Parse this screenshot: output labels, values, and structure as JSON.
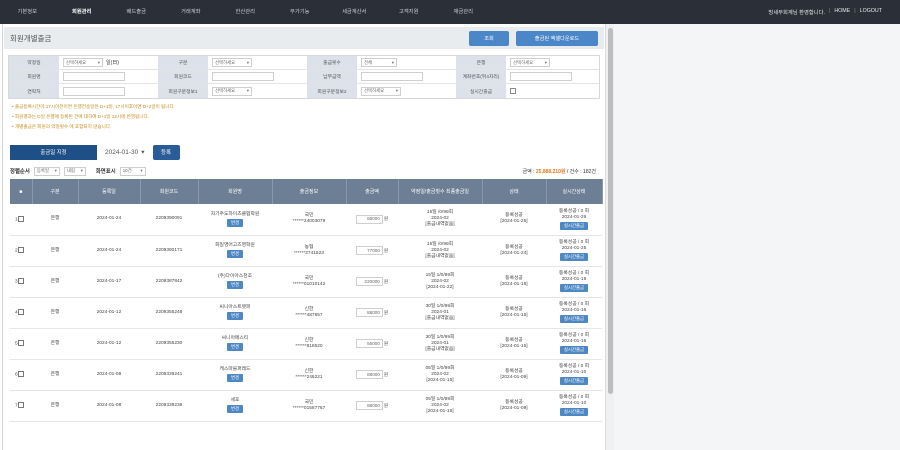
{
  "nav": {
    "items": [
      "기본정보",
      "회원관리",
      "배드출금",
      "거래계좌",
      "한산관리",
      "부가기능",
      "세금계산서",
      "고객지원",
      "재금관리"
    ],
    "right": {
      "user": "빙세무회계님 환영합니다.",
      "home": "HOME",
      "logout": "LOGOUT"
    }
  },
  "page": {
    "title": "회원개별출금",
    "search_button": "조회",
    "excel_button": "출금된 엑셀다운로드"
  },
  "filters": {
    "rows": [
      [
        {
          "label": "약정일",
          "value": "선택하세요",
          "extra": "일(日)"
        },
        {
          "label": "구분",
          "value": "선택하세요"
        },
        {
          "label": "출금횟수",
          "value": "전체"
        },
        {
          "label": "은행",
          "value": "선택하세요"
        }
      ],
      [
        {
          "label": "회원명",
          "value": ""
        },
        {
          "label": "회원코드",
          "value": ""
        },
        {
          "label": "납부금액",
          "value": ""
        },
        {
          "label": "계좌번호(뒤4자리)",
          "value": ""
        }
      ],
      [
        {
          "label": "연락처",
          "value": ""
        },
        {
          "label": "회원구분정보1",
          "value": "선택하세요"
        },
        {
          "label": "회원구분정보2",
          "value": "선택하세요"
        },
        {
          "label": "실시간출금",
          "value": ""
        }
      ]
    ]
  },
  "notes": [
    "• 출금등록시간이 17시이전이면 은행전송일은 D+1일, 17시이후이면 D+2일이 됩니다.",
    "• 회원결과는 D일 은행에 등록된 건에 대하여 D+1일 12시에 반영됩니다.",
    "• 개별출금은 회원의 약정횟수 에 포함되지 않습니다."
  ],
  "listhead": {
    "tab": "출금일 지정",
    "date": "2024-01-30",
    "register": "등록"
  },
  "sort": {
    "label": "정렬순서",
    "field": "등록일",
    "order": "내림",
    "display_label": "화면표시",
    "display_value": "10건"
  },
  "summary": {
    "prefix": "금액 :",
    "amount": "25,888,210원",
    "count": "/ 건수 : 182건"
  },
  "table": {
    "headers": [
      "■",
      "구분",
      "등록일",
      "회원코드",
      "회원명",
      "출금정보",
      "출금액",
      "약정일/출금횟수 최종출금일",
      "상태",
      "실시간상태"
    ],
    "rows": [
      {
        "no": "1",
        "type": "은행",
        "date": "2024-01-24",
        "code": "2209390091",
        "name": "자기주도하이츠클럽학원",
        "name_btn": "변경",
        "bank": "국민",
        "acct": "******24003079",
        "amount": "66000",
        "unit": "원",
        "plan1": "15일 /0/99회",
        "plan2": "2024-02",
        "plan3": "[출금내역없음]",
        "status1": "등록성공",
        "status2": "[2024-01-25]",
        "rt1": "등록성공 / 0 회",
        "rt2": "2024-01-26",
        "rt_btn": "실시간출금"
      },
      {
        "no": "2",
        "type": "은행",
        "date": "2024-01-24",
        "code": "2209390171",
        "name": "화일영어고즈영학원",
        "name_btn": "변경",
        "bank": "농협",
        "acct": "******2741523",
        "amount": "77000",
        "unit": "원",
        "plan1": "15일 /0/99회",
        "plan2": "2024-02",
        "plan3": "[출금내역없음]",
        "status1": "등록성공",
        "status2": "[2024-01-24]",
        "rt1": "등록성공 / 0 회",
        "rt2": "2024-01-25",
        "rt_btn": "실시간출금"
      },
      {
        "no": "3",
        "type": "은행",
        "date": "2024-01-17",
        "code": "2209387842",
        "name": "(주)다이아스천조",
        "name_btn": "변경",
        "bank": "국민",
        "acct": "******01010142",
        "amount": "220000",
        "unit": "원",
        "plan1": "15일 1/0/99회",
        "plan2": "2024-02",
        "plan3": "[2024-01-22]",
        "status1": "등록성공",
        "status2": "[2024-01-18]",
        "rt1": "등록성공 / 0 회",
        "rt2": "2024-01-19",
        "rt_btn": "실시간출금"
      },
      {
        "no": "4",
        "type": "은행",
        "date": "2024-01-12",
        "code": "2209355248",
        "name": "씨니아스트랫퍼",
        "name_btn": "변경",
        "bank": "신한",
        "acct": "******487657",
        "amount": "88000",
        "unit": "원",
        "plan1": "30일 1/0/99회",
        "plan2": "2024-01",
        "plan3": "[출금내역없음]",
        "status1": "등록성공",
        "status2": "[2024-01-15]",
        "rt1": "등록성공 / 0 회",
        "rt2": "2024-01-16",
        "rt_btn": "실시간출금"
      },
      {
        "no": "5",
        "type": "은행",
        "date": "2024-01-12",
        "code": "2209355230",
        "name": "씨니아메스티",
        "name_btn": "변경",
        "bank": "신한",
        "acct": "******818520",
        "amount": "55000",
        "unit": "원",
        "plan1": "30일 1/0/99회",
        "plan2": "2024-01",
        "plan3": "[출금내역없음]",
        "status1": "등록성공",
        "status2": "[2024-01-15]",
        "rt1": "등록성공 / 0 회",
        "rt2": "2024-01-16",
        "rt_btn": "실시간출금"
      },
      {
        "no": "6",
        "type": "은행",
        "date": "2024-01-08",
        "code": "2209339241",
        "name": "케스마블퍼레드",
        "name_btn": "변경",
        "bank": "신한",
        "acct": "******246221",
        "amount": "88000",
        "unit": "원",
        "plan1": "05일 1/0/99회",
        "plan2": "2024-02",
        "plan3": "[2024-01-15]",
        "status1": "등록성공",
        "status2": "[2024-01-09]",
        "rt1": "등록성공 / 0 회",
        "rt2": "2024-01-10",
        "rt_btn": "실시간출금"
      },
      {
        "no": "7",
        "type": "은행",
        "date": "2024-01-08",
        "code": "2209339236",
        "name": "세포",
        "name_btn": "변경",
        "bank": "국민",
        "acct": "******01587767",
        "amount": "88000",
        "unit": "원",
        "plan1": "05일 1/0/99회",
        "plan2": "2024-02",
        "plan3": "[2024-01-15]",
        "status1": "등록성공",
        "status2": "[2024-01-09]",
        "rt1": "등록성공 / 0 회",
        "rt2": "2024-01-10",
        "rt_btn": "실시간출금"
      }
    ]
  }
}
